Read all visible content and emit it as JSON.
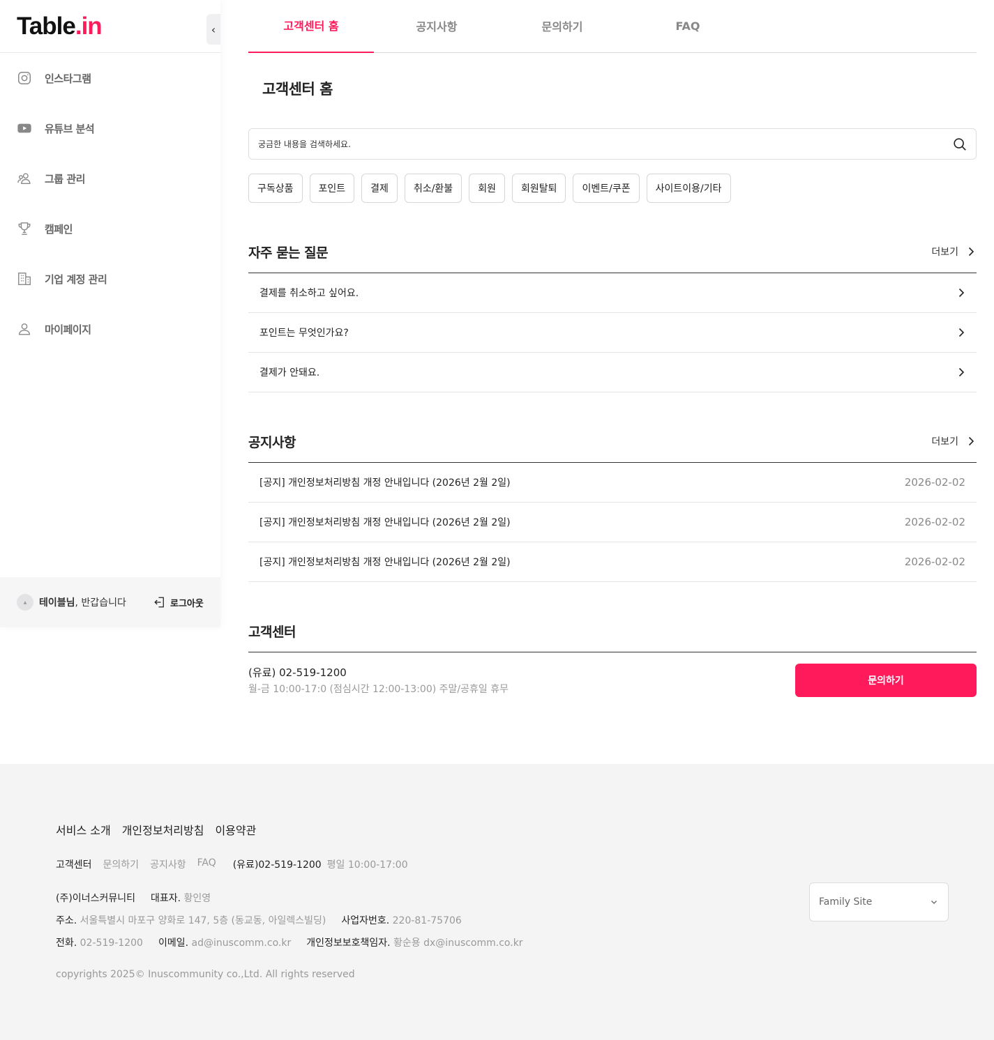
{
  "logo": {
    "main": "Table",
    "dot": ".",
    "suffix": "in"
  },
  "sidebar": {
    "collapse_glyph": "‹",
    "items": [
      {
        "label": "인스타그램",
        "icon": "instagram-icon"
      },
      {
        "label": "유튜브 분석",
        "icon": "youtube-icon"
      },
      {
        "label": "그룹 관리",
        "icon": "group-icon"
      },
      {
        "label": "캠페인",
        "icon": "trophy-icon"
      },
      {
        "label": "기업 계정 관리",
        "icon": "building-icon"
      },
      {
        "label": "마이페이지",
        "icon": "user-icon"
      }
    ],
    "user_name": "테이블님",
    "greeting": ", 반갑습니다",
    "logout": "로그아웃"
  },
  "tabs": [
    {
      "label": "고객센터 홈",
      "active": true
    },
    {
      "label": "공지사항",
      "active": false
    },
    {
      "label": "문의하기",
      "active": false
    },
    {
      "label": "FAQ",
      "active": false
    }
  ],
  "page_title": "고객센터 홈",
  "search": {
    "placeholder": "궁금한 내용을 검색하세요."
  },
  "categories": [
    "구독상품",
    "포인트",
    "결제",
    "취소/환불",
    "회원",
    "회원탈퇴",
    "이벤트/쿠폰",
    "사이트이용/기타"
  ],
  "faq": {
    "title": "자주 묻는 질문",
    "more": "더보기",
    "items": [
      "결제를 취소하고 싶어요.",
      "포인트는 무엇인가요?",
      "결제가 안돼요."
    ]
  },
  "notice": {
    "title": "공지사항",
    "more": "더보기",
    "items": [
      {
        "title": "[공지] 개인정보처리방침 개정 안내입니다 (2026년 2월 2일)",
        "date": "2026-02-02"
      },
      {
        "title": "[공지] 개인정보처리방침 개정 안내입니다 (2026년 2월 2일)",
        "date": "2026-02-02"
      },
      {
        "title": "[공지] 개인정보처리방침 개정 안내입니다 (2026년 2월 2일)",
        "date": "2026-02-02"
      }
    ]
  },
  "cs": {
    "title": "고객센터",
    "phone": "(유료) 02-519-1200",
    "hours": "월-금 10:00-17:0 (점심시간 12:00-13:00) 주말/공휴일 휴무",
    "button": "문의하기"
  },
  "footer": {
    "links": [
      "서비스 소개",
      "개인정보처리방침",
      "이용약관"
    ],
    "cs_label": "고객센터",
    "cs_links": [
      "문의하기",
      "공지사항",
      "FAQ"
    ],
    "cs_phone": "(유료)02-519-1200",
    "cs_hours": "평일 10:00-17:00",
    "company": "(주)이너스커뮤니티",
    "ceo_label": "대표자.",
    "ceo": "황인영",
    "address_label": "주소.",
    "address": "서울특별시 마포구 양화로 147, 5층 (동교동, 아일렉스빌딩)",
    "bizno_label": "사업자번호.",
    "bizno": "220-81-75706",
    "tel_label": "전화.",
    "tel": "02-519-1200",
    "email_label": "이메일.",
    "email": "ad@inuscomm.co.kr",
    "privacy_label": "개인정보보호책임자.",
    "privacy": "황순용 dx@inuscomm.co.kr",
    "copyright": "copyrights 2025© Inuscommunity co.,Ltd. All rights reserved",
    "family_site": "Family Site"
  },
  "colors": {
    "accent": "#ff1a5b",
    "muted": "#999999",
    "footer_bg": "#f4f4f5"
  }
}
